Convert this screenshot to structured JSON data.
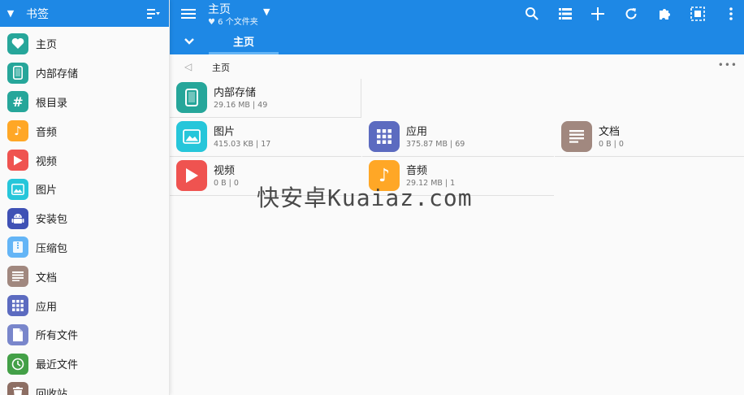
{
  "sidebar": {
    "title": "书签",
    "items": [
      {
        "label": "主页",
        "icon": "heart-icon",
        "color": "#26a69a"
      },
      {
        "label": "内部存储",
        "icon": "phone-icon",
        "color": "#26a69a"
      },
      {
        "label": "根目录",
        "icon": "hash-icon",
        "color": "#26a69a"
      },
      {
        "label": "音频",
        "icon": "music-note-icon",
        "color": "#ffa726"
      },
      {
        "label": "视频",
        "icon": "play-icon",
        "color": "#ef5350"
      },
      {
        "label": "图片",
        "icon": "image-icon",
        "color": "#26c6da"
      },
      {
        "label": "安装包",
        "icon": "android-icon",
        "color": "#3f51b5"
      },
      {
        "label": "压缩包",
        "icon": "archive-icon",
        "color": "#64b5f6"
      },
      {
        "label": "文档",
        "icon": "document-icon",
        "color": "#a1887f"
      },
      {
        "label": "应用",
        "icon": "apps-grid-icon",
        "color": "#5c6bc0"
      },
      {
        "label": "所有文件",
        "icon": "file-icon",
        "color": "#7986cb"
      },
      {
        "label": "最近文件",
        "icon": "clock-icon",
        "color": "#43a047"
      },
      {
        "label": "回收站",
        "icon": "trash-icon",
        "color": "#8d6e63"
      }
    ]
  },
  "topbar": {
    "title": "主页",
    "subtitle": "6 个文件夹",
    "actions": [
      "search-icon",
      "list-view-icon",
      "add-icon",
      "refresh-icon",
      "extension-icon",
      "select-all-icon",
      "more-vert-icon"
    ]
  },
  "tabs": [
    {
      "label": "主页"
    }
  ],
  "pathbar": {
    "path": "主页"
  },
  "tiles": [
    {
      "name": "内部存储",
      "meta": "29.16 MB | 49",
      "icon": "phone-icon",
      "color": "#26a69a"
    },
    {
      "name": "图片",
      "meta": "415.03  KB | 17",
      "icon": "image-icon",
      "color": "#26c6da"
    },
    {
      "name": "应用",
      "meta": "375.87 MB | 69",
      "icon": "apps-grid-icon",
      "color": "#5c6bc0"
    },
    {
      "name": "文档",
      "meta": "0 B | 0",
      "icon": "document-icon",
      "color": "#a1887f"
    },
    {
      "name": "视频",
      "meta": "0 B | 0",
      "icon": "play-icon",
      "color": "#ef5350"
    },
    {
      "name": "音频",
      "meta": "29.12 MB | 1",
      "icon": "music-note-icon",
      "color": "#ffa726"
    }
  ],
  "watermark": "快安卓Kuaiaz.com",
  "colors": {
    "primary": "#1e88e5",
    "tab_indicator": "#64b5f6"
  }
}
